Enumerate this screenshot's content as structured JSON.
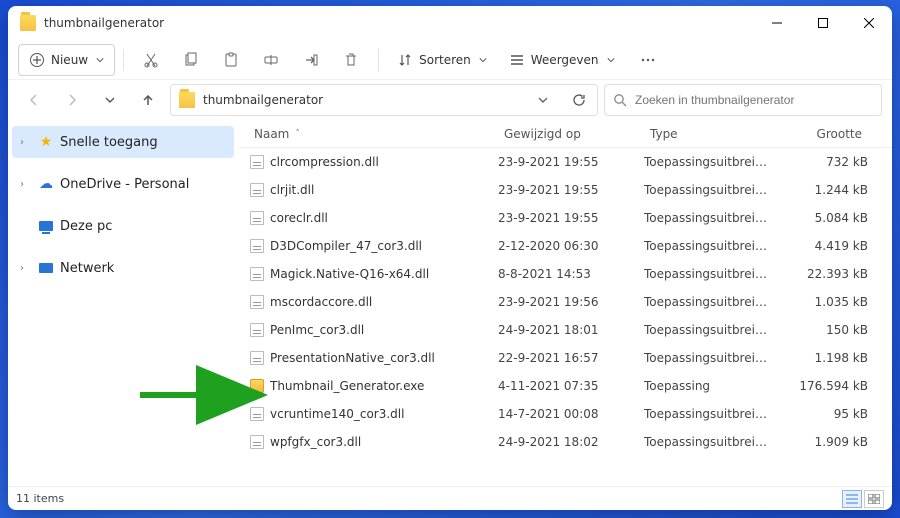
{
  "window": {
    "title": "thumbnailgenerator"
  },
  "toolbar": {
    "new_label": "Nieuw",
    "sort_label": "Sorteren",
    "view_label": "Weergeven"
  },
  "address": {
    "path_label": "thumbnailgenerator"
  },
  "search": {
    "placeholder": "Zoeken in thumbnailgenerator"
  },
  "sidebar": {
    "items": [
      {
        "label": "Snelle toegang",
        "icon": "star",
        "expandable": true,
        "selected": true
      },
      {
        "label": "OneDrive - Personal",
        "icon": "cloud",
        "expandable": true,
        "selected": false
      },
      {
        "label": "Deze pc",
        "icon": "pc",
        "expandable": false,
        "selected": false
      },
      {
        "label": "Netwerk",
        "icon": "net",
        "expandable": true,
        "selected": false
      }
    ]
  },
  "columns": {
    "name": "Naam",
    "modified": "Gewijzigd op",
    "type": "Type",
    "size": "Grootte"
  },
  "files": [
    {
      "name": "clrcompression.dll",
      "modified": "23-9-2021 19:55",
      "type": "Toepassingsuitbreidi...",
      "size": "732 kB",
      "kind": "dll"
    },
    {
      "name": "clrjit.dll",
      "modified": "23-9-2021 19:55",
      "type": "Toepassingsuitbreidi...",
      "size": "1.244 kB",
      "kind": "dll"
    },
    {
      "name": "coreclr.dll",
      "modified": "23-9-2021 19:55",
      "type": "Toepassingsuitbreidi...",
      "size": "5.084 kB",
      "kind": "dll"
    },
    {
      "name": "D3DCompiler_47_cor3.dll",
      "modified": "2-12-2020 06:30",
      "type": "Toepassingsuitbreidi...",
      "size": "4.419 kB",
      "kind": "dll"
    },
    {
      "name": "Magick.Native-Q16-x64.dll",
      "modified": "8-8-2021 14:53",
      "type": "Toepassingsuitbreidi...",
      "size": "22.393 kB",
      "kind": "dll"
    },
    {
      "name": "mscordaccore.dll",
      "modified": "23-9-2021 19:56",
      "type": "Toepassingsuitbreidi...",
      "size": "1.035 kB",
      "kind": "dll"
    },
    {
      "name": "PenImc_cor3.dll",
      "modified": "24-9-2021 18:01",
      "type": "Toepassingsuitbreidi...",
      "size": "150 kB",
      "kind": "dll"
    },
    {
      "name": "PresentationNative_cor3.dll",
      "modified": "22-9-2021 16:57",
      "type": "Toepassingsuitbreidi...",
      "size": "1.198 kB",
      "kind": "dll"
    },
    {
      "name": "Thumbnail_Generator.exe",
      "modified": "4-11-2021 07:35",
      "type": "Toepassing",
      "size": "176.594 kB",
      "kind": "exe"
    },
    {
      "name": "vcruntime140_cor3.dll",
      "modified": "14-7-2021 00:08",
      "type": "Toepassingsuitbreidi...",
      "size": "95 kB",
      "kind": "dll"
    },
    {
      "name": "wpfgfx_cor3.dll",
      "modified": "24-9-2021 18:02",
      "type": "Toepassingsuitbreidi...",
      "size": "1.909 kB",
      "kind": "dll"
    }
  ],
  "status": {
    "item_count": "11 items"
  }
}
